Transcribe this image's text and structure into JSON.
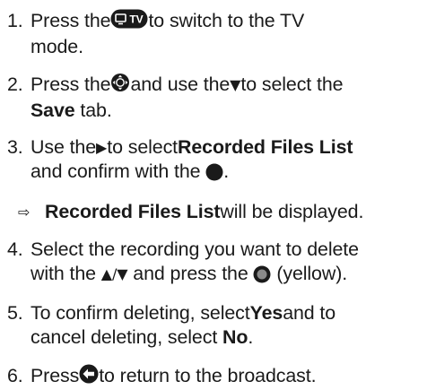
{
  "steps": [
    {
      "num": "1.",
      "a": "Press the ",
      "b": " to switch to the TV",
      "c": "mode."
    },
    {
      "num": "2.",
      "a": "Press the ",
      "b": " and use the ",
      "c": " to select the",
      "d": "Save",
      "e": " tab."
    },
    {
      "num": "3.",
      "a": "Use the ",
      "b": " to select ",
      "c": "Recorded Files List",
      "d": "and confirm with the ",
      "e": "."
    },
    {
      "arrow": "⇨",
      "a": "Recorded Files List",
      "b": " will be displayed."
    },
    {
      "num": "4.",
      "a": "Select the recording you want to delete",
      "b": "with the ",
      "c": " and press the ",
      "d": " (yellow)."
    },
    {
      "num": "5.",
      "a": "To confirm deleting, select ",
      "b": "Yes",
      "c": " and to",
      "d": "cancel deleting, select ",
      "e": "No",
      "f": "."
    },
    {
      "num": "6.",
      "a": "Press ",
      "b": " to return to the broadcast."
    }
  ],
  "icons": {
    "tv_button_label": "TV",
    "down_glyph": "▼",
    "right_glyph": "▶",
    "up_down_glyph": "▲/▼"
  }
}
